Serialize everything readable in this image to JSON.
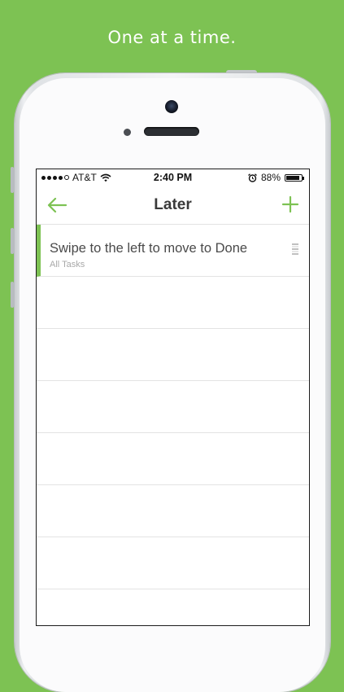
{
  "headline": "One at a time.",
  "colors": {
    "background": "#7dc253",
    "accent": "#7dc253"
  },
  "status_bar": {
    "carrier": "AT&T",
    "signal_bars": 4,
    "signal_total": 5,
    "time": "2:40 PM",
    "battery_percent": "88%",
    "battery_level": 0.88,
    "icons": [
      "signal-dots-icon",
      "wifi-icon",
      "alarm-icon",
      "battery-icon"
    ]
  },
  "navbar": {
    "title": "Later",
    "back_icon": "arrow-left-icon",
    "add_icon": "plus-icon"
  },
  "tasks": [
    {
      "title": "Swipe to the left to move to Done",
      "list": "All Tasks"
    }
  ],
  "empty_rows": 6
}
